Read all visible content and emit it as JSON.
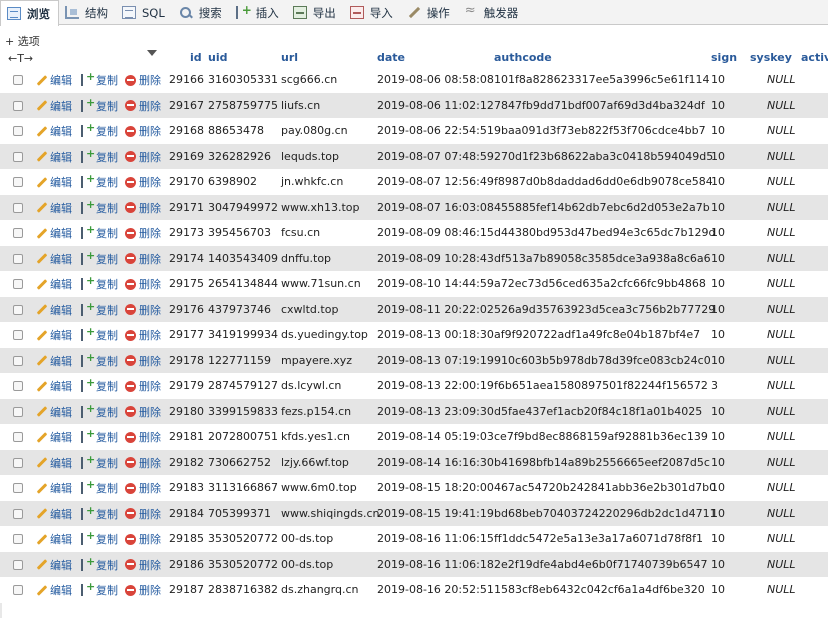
{
  "tabs": [
    {
      "label": "浏览",
      "icon": "browse-icon",
      "active": true
    },
    {
      "label": "结构",
      "icon": "structure-icon"
    },
    {
      "label": "SQL",
      "icon": "sql-icon"
    },
    {
      "label": "搜索",
      "icon": "search-icon"
    },
    {
      "label": "插入",
      "icon": "insert-icon"
    },
    {
      "label": "导出",
      "icon": "export-icon"
    },
    {
      "label": "导入",
      "icon": "import-icon"
    },
    {
      "label": "操作",
      "icon": "operations-icon"
    },
    {
      "label": "触发器",
      "icon": "triggers-icon"
    }
  ],
  "options_label": "+ 选项",
  "column_arrows": "←T→",
  "columns": [
    "id",
    "uid",
    "url",
    "date",
    "authcode",
    "sign",
    "syskey",
    "activ"
  ],
  "actions": {
    "edit": "编辑",
    "copy": "复制",
    "delete": "删除"
  },
  "rows": [
    [
      "29166",
      "3160305331",
      "scg666.cn",
      "2019-08-06 08:58:08",
      "101f8a828623317ee5a3996c5e61f114",
      "10",
      "NULL"
    ],
    [
      "29167",
      "2758759775",
      "liufs.cn",
      "2019-08-06 11:02:12",
      "7847fb9dd71bdf007af69d3d4ba324df",
      "10",
      "NULL"
    ],
    [
      "29168",
      "88653478",
      "pay.080g.cn",
      "2019-08-06 22:54:51",
      "9baa091d3f73eb822f53f706cdce4bb7",
      "10",
      "NULL"
    ],
    [
      "29169",
      "326282926",
      "lequds.top",
      "2019-08-07 07:48:59",
      "270d1f23b68622aba3c0418b594049d5",
      "10",
      "NULL"
    ],
    [
      "29170",
      "6398902",
      "jn.whkfc.cn",
      "2019-08-07 12:56:49",
      "f8987d0b8daddad6dd0e6db9078ce584",
      "10",
      "NULL"
    ],
    [
      "29171",
      "3047949972",
      "www.xh13.top",
      "2019-08-07 16:03:08",
      "455885fef14b62db7ebc6d2d053e2a7b",
      "10",
      "NULL"
    ],
    [
      "29173",
      "395456703",
      "fcsu.cn",
      "2019-08-09 08:46:15",
      "d44380bd953d47bed94e3c65dc7b129d",
      "10",
      "NULL"
    ],
    [
      "29174",
      "1403543409",
      "dnffu.top",
      "2019-08-09 10:28:43",
      "df513a7b89058c3585dce3a938a8c6a6",
      "10",
      "NULL"
    ],
    [
      "29175",
      "2654134844",
      "www.71sun.cn",
      "2019-08-10 14:44:59",
      "a72ec73d56ced635a2cfc66fc9bb4868",
      "10",
      "NULL"
    ],
    [
      "29176",
      "437973746",
      "cxwltd.top",
      "2019-08-11 20:22:02",
      "526a9d35763923d5cea3c756b2b77729",
      "10",
      "NULL"
    ],
    [
      "29177",
      "3419199934",
      "ds.yuedingy.top",
      "2019-08-13 00:18:30",
      "af9f920722adf1a49fc8e04b187bf4e7",
      "10",
      "NULL"
    ],
    [
      "29178",
      "122771159",
      "mpayere.xyz",
      "2019-08-13 07:19:19",
      "910c603b5b978db78d39fce083cb24c0",
      "10",
      "NULL"
    ],
    [
      "29179",
      "2874579127",
      "ds.lcywl.cn",
      "2019-08-13 22:00:19",
      "f6b651aea1580897501f82244f156572",
      "3",
      "NULL"
    ],
    [
      "29180",
      "3399159833",
      "fezs.p154.cn",
      "2019-08-13 23:09:30",
      "d5fae437ef1acb20f84c18f1a01b4025",
      "10",
      "NULL"
    ],
    [
      "29181",
      "2072800751",
      "kfds.yes1.cn",
      "2019-08-14 05:19:03",
      "ce7f9bd8ec8868159af92881b36ec139",
      "10",
      "NULL"
    ],
    [
      "29182",
      "730662752",
      "lzjy.66wf.top",
      "2019-08-14 16:16:30",
      "b41698bfb14a89b2556665eef2087d5c",
      "10",
      "NULL"
    ],
    [
      "29183",
      "3113166867",
      "www.6m0.top",
      "2019-08-15 18:20:00",
      "467ac54720b242841abb36e2b301d7b0",
      "10",
      "NULL"
    ],
    [
      "29184",
      "705399371",
      "www.shiqingds.cn",
      "2019-08-15 19:41:19",
      "bd68beb70403724220296db2dc1d4711",
      "10",
      "NULL"
    ],
    [
      "29185",
      "3530520772",
      "00-ds.top",
      "2019-08-16 11:06:15",
      "ff1ddc5472e5a13e3a17a6071d78f8f1",
      "10",
      "NULL"
    ],
    [
      "29186",
      "3530520772",
      "00-ds.top",
      "2019-08-16 11:06:18",
      "2e2f19dfe4abd4e6b0f71740739b6547",
      "10",
      "NULL"
    ],
    [
      "29187",
      "2838716382",
      "ds.zhangrq.cn",
      "2019-08-16 20:52:51",
      "1583cf8eb6432c042cf6a1a4df6be320",
      "10",
      "NULL"
    ]
  ]
}
